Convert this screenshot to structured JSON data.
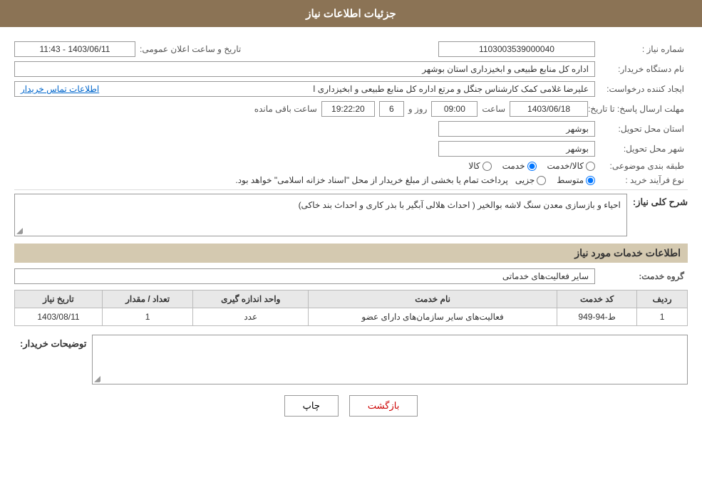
{
  "page": {
    "title": "جزئیات اطلاعات نیاز",
    "sections": {
      "main_info": {
        "label": "جزئیات اطلاعات نیاز",
        "fields": {
          "need_number_label": "شماره نیاز :",
          "need_number_value": "1103003539000040",
          "announcement_date_label": "تاریخ و ساعت اعلان عمومی:",
          "announcement_date_value": "1403/06/11 - 11:43",
          "buyer_org_label": "نام دستگاه خریدار:",
          "buyer_org_value": "اداره کل منابع طبیعی و ابخیزداری استان بوشهر",
          "creator_label": "ایجاد کننده درخواست:",
          "creator_value": "علیرضا غلامی کمک کارشناس جنگل و مرتع اداره کل منابع طبیعی و ابخیزداری ا",
          "contact_link": "اطلاعات تماس خریدار",
          "response_deadline_label": "مهلت ارسال پاسخ: تا تاریخ:",
          "response_date_value": "1403/06/18",
          "response_time_label": "ساعت",
          "response_time_value": "09:00",
          "response_day_label": "روز و",
          "response_day_value": "6",
          "response_clock_value": "19:22:20",
          "remaining_label": "ساعت باقی مانده",
          "delivery_province_label": "استان محل تحویل:",
          "delivery_province_value": "بوشهر",
          "delivery_city_label": "شهر محل تحویل:",
          "delivery_city_value": "بوشهر",
          "category_label": "طبقه بندی موضوعی:",
          "category_options": [
            "کالا",
            "خدمت",
            "کالا/خدمت"
          ],
          "category_selected": "خدمت",
          "purchase_type_label": "نوع فرآیند خرید :",
          "purchase_type_options": [
            "جزیی",
            "متوسط"
          ],
          "purchase_type_selected": "متوسط",
          "purchase_note": "پرداخت تمام یا بخشی از مبلغ خریدار از محل \"اسناد خزانه اسلامی\" خواهد بود."
        }
      },
      "general_description": {
        "label": "شرح کلی نیاز:",
        "value": "احیاء و بازسازی معدن سنگ لاشه بوالخیر ( احداث هلالی آبگیر با بذر کاری و احداث بند خاکی)"
      },
      "services_info": {
        "label": "اطلاعات خدمات مورد نیاز",
        "service_group_label": "گروه خدمت:",
        "service_group_value": "سایر فعالیت‌های خدماتی",
        "table": {
          "headers": [
            "ردیف",
            "کد خدمت",
            "نام خدمت",
            "واحد اندازه گیری",
            "تعداد / مقدار",
            "تاریخ نیاز"
          ],
          "rows": [
            {
              "row_num": "1",
              "service_code": "ط-94-949",
              "service_name": "فعالیت‌های سایر سازمان‌های دارای عضو",
              "unit": "عدد",
              "quantity": "1",
              "date": "1403/08/11"
            }
          ]
        }
      },
      "buyer_notes": {
        "label": "توضیحات خریدار:",
        "value": ""
      }
    },
    "buttons": {
      "print": "چاپ",
      "back": "بازگشت"
    }
  }
}
